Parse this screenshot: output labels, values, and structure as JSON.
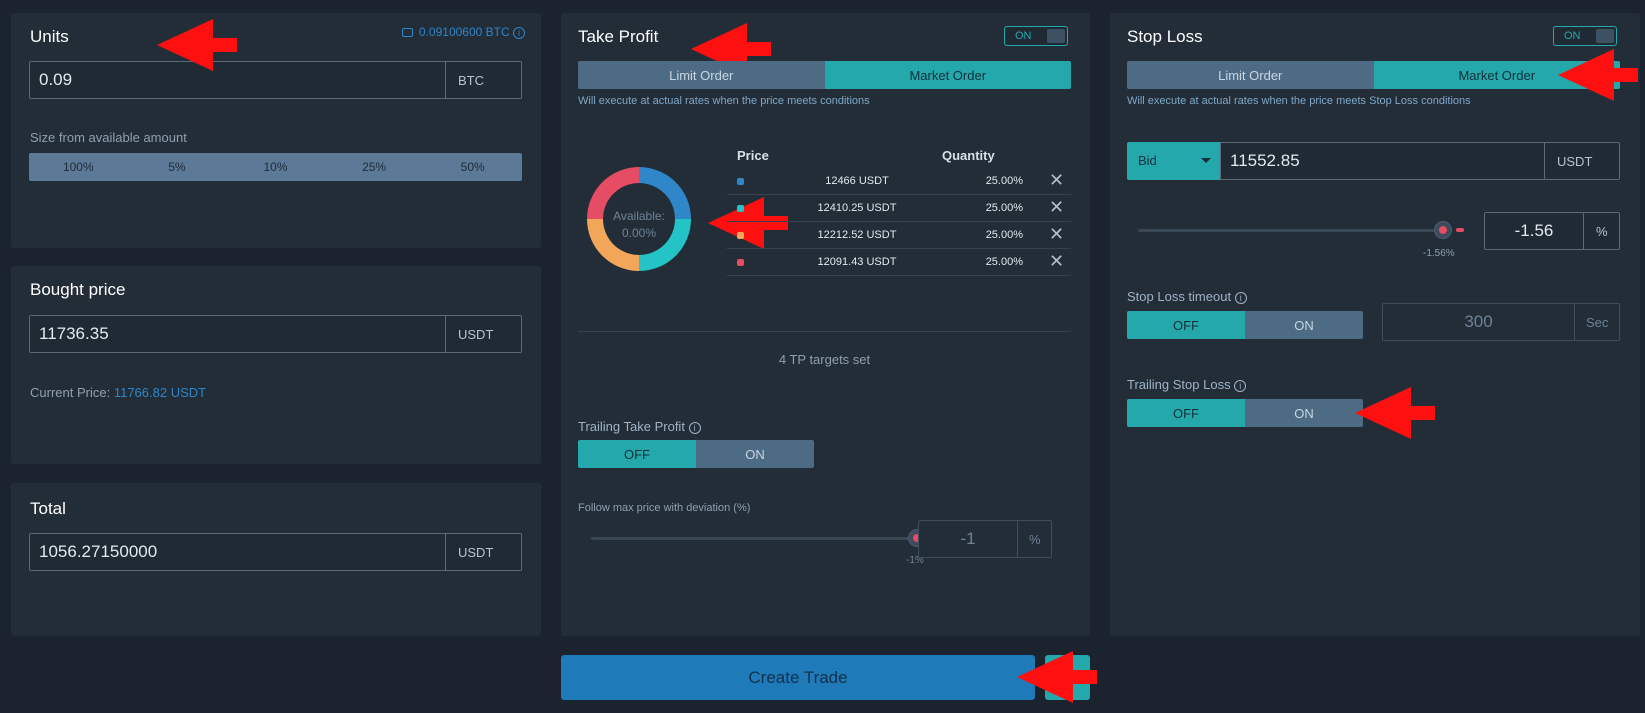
{
  "units": {
    "title": "Units",
    "balance": "0.09100600 BTC",
    "value": "0.09",
    "unit": "BTC",
    "size_label": "Size from available amount",
    "percents": [
      "100%",
      "5%",
      "10%",
      "25%",
      "50%"
    ]
  },
  "bought": {
    "title": "Bought price",
    "value": "11736.35",
    "unit": "USDT",
    "current_label": "Current Price:",
    "current_value": "11766.82 USDT"
  },
  "total": {
    "title": "Total",
    "value": "1056.27150000",
    "unit": "USDT"
  },
  "take_profit": {
    "title": "Take Profit",
    "toggle": "ON",
    "limit_label": "Limit Order",
    "market_label": "Market Order",
    "note": "Will execute at actual rates when the price meets conditions",
    "available_label": "Available:",
    "available_value": "0.00%",
    "col_price": "Price",
    "col_qty": "Quantity",
    "rows": [
      {
        "price": "12466 USDT",
        "qty": "25.00%",
        "color": "#2f86c8"
      },
      {
        "price": "12410.25 USDT",
        "qty": "25.00%",
        "color": "#24c3c6"
      },
      {
        "price": "12212.52 USDT",
        "qty": "25.00%",
        "color": "#f2a65a"
      },
      {
        "price": "12091.43 USDT",
        "qty": "25.00%",
        "color": "#e64c63"
      }
    ],
    "targets_set": "4 TP targets set",
    "trailing_label": "Trailing Take Profit",
    "off_label": "OFF",
    "on_label": "ON",
    "follow_label": "Follow max price with deviation (%)",
    "slider_value": "-1%",
    "deviation_value": "-1",
    "deviation_unit": "%"
  },
  "stop_loss": {
    "title": "Stop Loss",
    "toggle": "ON",
    "limit_label": "Limit Order",
    "market_label": "Market Order",
    "note": "Will execute at actual rates when the price meets Stop Loss conditions",
    "bid_label": "Bid",
    "price_value": "11552.85",
    "price_unit": "USDT",
    "slider_value": "-1.56%",
    "pct_value": "-1.56",
    "pct_unit": "%",
    "timeout_label": "Stop Loss timeout",
    "off_label": "OFF",
    "on_label": "ON",
    "timeout_value": "300",
    "timeout_unit": "Sec",
    "trailing_label": "Trailing Stop Loss"
  },
  "footer": {
    "create_label": "Create Trade"
  }
}
